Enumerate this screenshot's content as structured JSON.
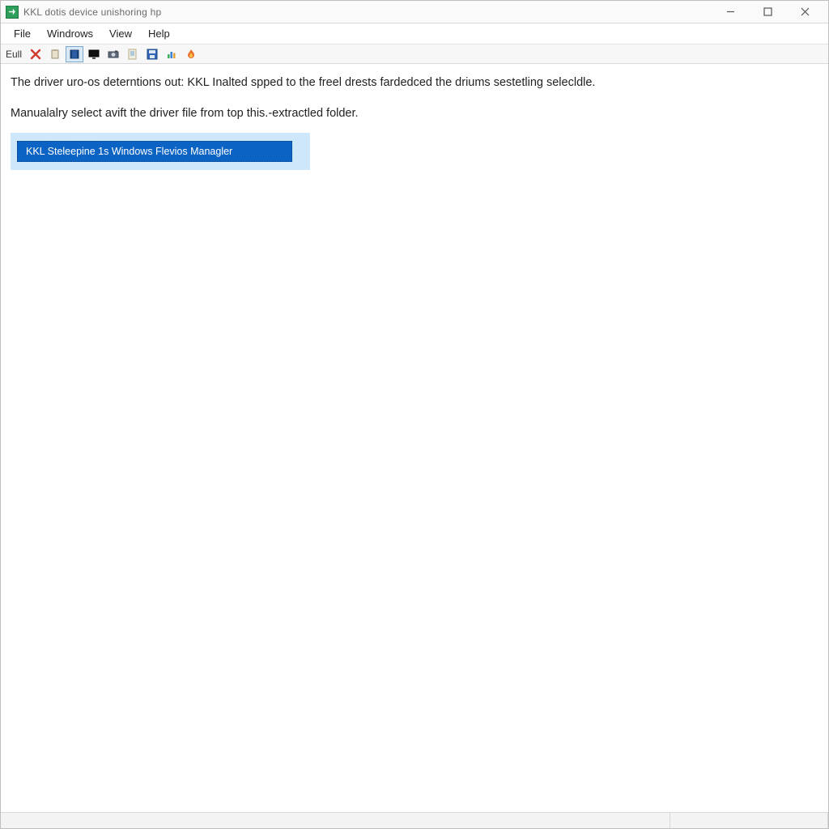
{
  "titlebar": {
    "title": "KKL dotis device unishoring hp"
  },
  "menubar": {
    "items": [
      "File",
      "Windrows",
      "View",
      "Help"
    ]
  },
  "toolbar": {
    "text_label": "Eull",
    "icons": [
      {
        "name": "close-red-icon"
      },
      {
        "name": "clipboard-icon"
      },
      {
        "name": "film-icon"
      },
      {
        "name": "monitor-icon"
      },
      {
        "name": "camera-icon"
      },
      {
        "name": "note-icon"
      },
      {
        "name": "save-icon"
      },
      {
        "name": "chart-icon"
      },
      {
        "name": "flame-icon"
      }
    ]
  },
  "content": {
    "line1": "The driver uro-os deterntions out: KKL Inalted spped to the freel drests fardedced the driums sestetling selecldle.",
    "line2": "Manualalry select avift the driver file from top this.-extractled folder.",
    "list_item": "KKL Steleepine 1s Windows Flevios Managler"
  },
  "statusbar": {
    "left": "",
    "right": ""
  }
}
